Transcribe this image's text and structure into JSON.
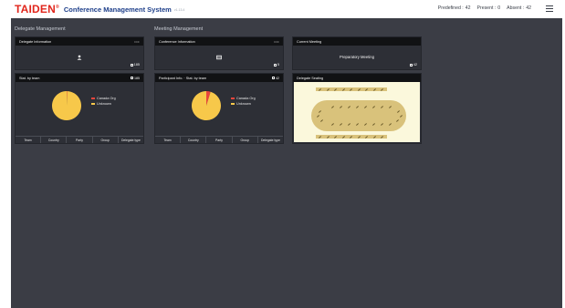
{
  "header": {
    "logo": "TAIDEN",
    "logo_mark": "®",
    "title": "Conference Management System",
    "version": "v1.13.4",
    "predefined_label": "Predefined :",
    "predefined_value": "42",
    "present_label": "Present :",
    "present_value": "0",
    "absent_label": "Absent :",
    "absent_value": "42"
  },
  "sections": {
    "delegate": "Delegate Management",
    "meeting": "Meeting Management"
  },
  "panels": {
    "delegate_info": {
      "title": "Delegate Information",
      "more": "•••",
      "count": "185",
      "icon": "user-icon"
    },
    "conference_info": {
      "title": "Conference Information",
      "more": "•••",
      "count": "5",
      "icon": "conference-icon"
    },
    "current_meeting": {
      "title": "Current Meeting",
      "meeting_name": "Preparatory Meeting",
      "count": "42"
    },
    "stat_team": {
      "title": "Stat. by team",
      "count": "185",
      "legend": [
        "Canada Org",
        "Unknown"
      ],
      "tabs": [
        "Team",
        "Country",
        "Party",
        "Group",
        "Delegate type"
      ]
    },
    "participant_stat": {
      "title": "Participant Info. · Stat. by team",
      "count": "42",
      "legend": [
        "Canada Org",
        "Unknown"
      ],
      "tabs": [
        "Team",
        "Country",
        "Party",
        "Group",
        "Delegate type"
      ]
    },
    "seating": {
      "title": "Delegate Seating"
    }
  },
  "colors": {
    "canada_org": "#e8453c",
    "unknown": "#f7c84a",
    "seat_table": "#d9c27b",
    "seating_bg": "#fbf8dc"
  },
  "chart_data": [
    {
      "type": "pie",
      "series": [
        {
          "name": "Canada Org",
          "value": 1
        },
        {
          "name": "Unknown",
          "value": 184
        }
      ]
    },
    {
      "type": "pie",
      "series": [
        {
          "name": "Canada Org",
          "value": 2
        },
        {
          "name": "Unknown",
          "value": 40
        }
      ]
    }
  ]
}
